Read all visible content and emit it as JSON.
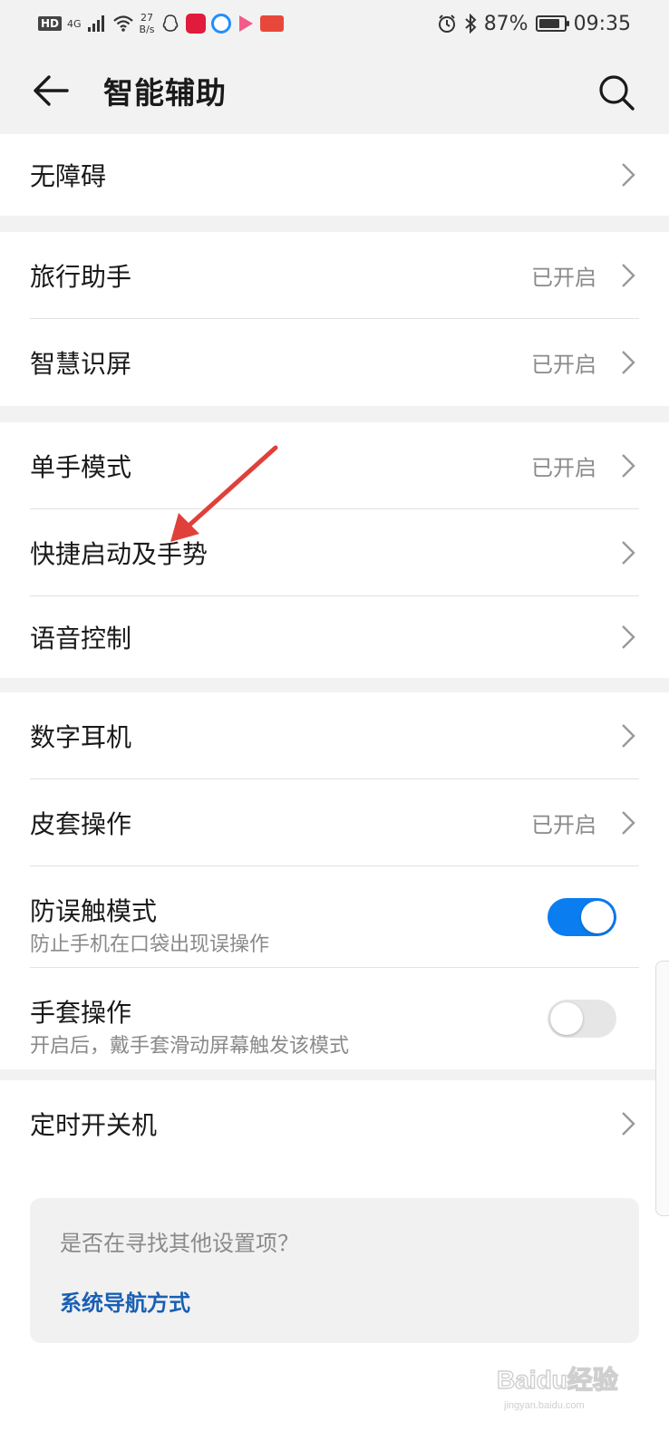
{
  "status_bar": {
    "hd": "HD",
    "network": "4G",
    "speed_value": "27",
    "speed_unit": "B/s",
    "battery_percent": "87%",
    "battery_level": 0.87,
    "time": "09:35"
  },
  "header": {
    "title": "智能辅助"
  },
  "sections": {
    "s1": {
      "items": [
        {
          "label": "无障碍"
        }
      ]
    },
    "s2": {
      "items": [
        {
          "label": "旅行助手",
          "status": "已开启"
        },
        {
          "label": "智慧识屏",
          "status": "已开启"
        }
      ]
    },
    "s3": {
      "items": [
        {
          "label": "单手模式",
          "status": "已开启"
        },
        {
          "label": "快捷启动及手势"
        },
        {
          "label": "语音控制"
        }
      ]
    },
    "s4": {
      "items": [
        {
          "label": "数字耳机"
        },
        {
          "label": "皮套操作",
          "status": "已开启"
        },
        {
          "label": "防误触模式",
          "sub": "防止手机在口袋出现误操作",
          "toggle": true
        },
        {
          "label": "手套操作",
          "sub": "开启后，戴手套滑动屏幕触发该模式",
          "toggle": false
        }
      ]
    },
    "s5": {
      "items": [
        {
          "label": "定时开关机"
        }
      ]
    }
  },
  "suggestion": {
    "question": "是否在寻找其他设置项？",
    "link": "系统导航方式"
  },
  "watermark": {
    "text": "Baidu经验",
    "subtext": "jingyan.baidu.com"
  },
  "colors": {
    "accent": "#0a7df0",
    "link": "#1a5fb4",
    "annotation_arrow": "#e0403a"
  },
  "icons": {
    "back": "arrow-left-icon",
    "search": "search-icon",
    "chevron": "chevron-right-icon"
  }
}
